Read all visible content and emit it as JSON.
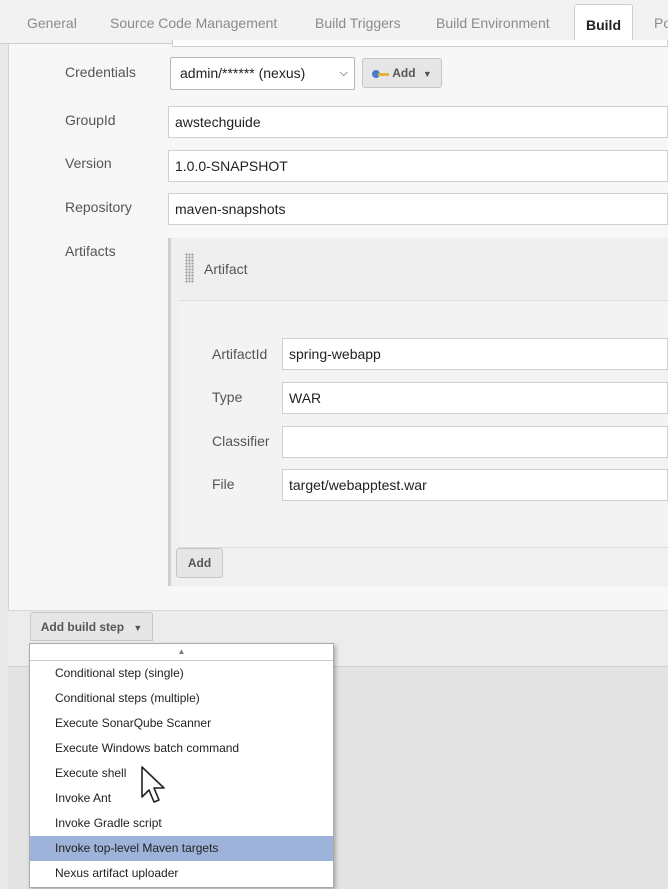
{
  "tabs": [
    {
      "label": "General",
      "active": false
    },
    {
      "label": "Source Code Management",
      "active": false
    },
    {
      "label": "Build Triggers",
      "active": false
    },
    {
      "label": "Build Environment",
      "active": false
    },
    {
      "label": "Build",
      "active": true
    },
    {
      "label": "Po",
      "active": false
    }
  ],
  "form": {
    "credentials_label": "Credentials",
    "credentials_value": "admin/****** (nexus)",
    "add_credential_label": "Add",
    "groupid_label": "GroupId",
    "groupid_value": "awstechguide",
    "version_label": "Version",
    "version_value": "1.0.0-SNAPSHOT",
    "repository_label": "Repository",
    "repository_value": "maven-snapshots",
    "artifacts_label": "Artifacts"
  },
  "artifact": {
    "header": "Artifact",
    "artifactid_label": "ArtifactId",
    "artifactid_value": "spring-webapp",
    "type_label": "Type",
    "type_value": "WAR",
    "classifier_label": "Classifier",
    "classifier_value": "",
    "file_label": "File",
    "file_value": "target/webapptest.war",
    "add_label": "Add"
  },
  "add_build_step": {
    "label": "Add build step",
    "options": [
      "Conditional step (single)",
      "Conditional steps (multiple)",
      "Execute SonarQube Scanner",
      "Execute Windows batch command",
      "Execute shell",
      "Invoke Ant",
      "Invoke Gradle script",
      "Invoke top-level Maven targets",
      "Nexus artifact uploader"
    ],
    "highlighted": "Invoke top-level Maven targets"
  },
  "icons": {
    "credential_add": "key-icon",
    "dropdown_arrow": "caret-down-icon",
    "scroll_up": "scroll-up-icon",
    "drag_handle": "drag-handle-icon",
    "pointer": "mouse-cursor-icon"
  },
  "colors": {
    "highlight": "#9db3d9",
    "active_tab_text": "#222222",
    "inactive_tab_text": "#8b8b8b"
  }
}
